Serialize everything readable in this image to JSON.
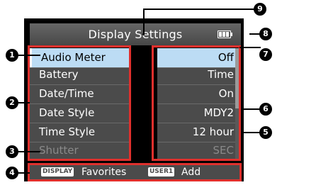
{
  "screen": {
    "title": "Display Settings",
    "battery_icon": "battery-full-icon"
  },
  "menu": {
    "items": [
      {
        "label": "Audio Meter",
        "value": "Off",
        "selected": true
      },
      {
        "label": "Battery",
        "value": "Time"
      },
      {
        "label": "Date/Time",
        "value": "On"
      },
      {
        "label": "Date Style",
        "value": "MDY2"
      },
      {
        "label": "Time Style",
        "value": "12 hour"
      },
      {
        "label": "Shutter",
        "value": "SEC",
        "disabled": true
      }
    ]
  },
  "footer": {
    "display_button": "DISPLAY",
    "display_action": "Favorites",
    "user1_button": "USER1",
    "user1_action": "Add"
  },
  "callouts": [
    "1",
    "2",
    "3",
    "4",
    "5",
    "6",
    "7",
    "8",
    "9"
  ],
  "colors": {
    "highlight": "#bcdcf4",
    "outline": "#e0302d",
    "panel": "#4b4b4b"
  }
}
